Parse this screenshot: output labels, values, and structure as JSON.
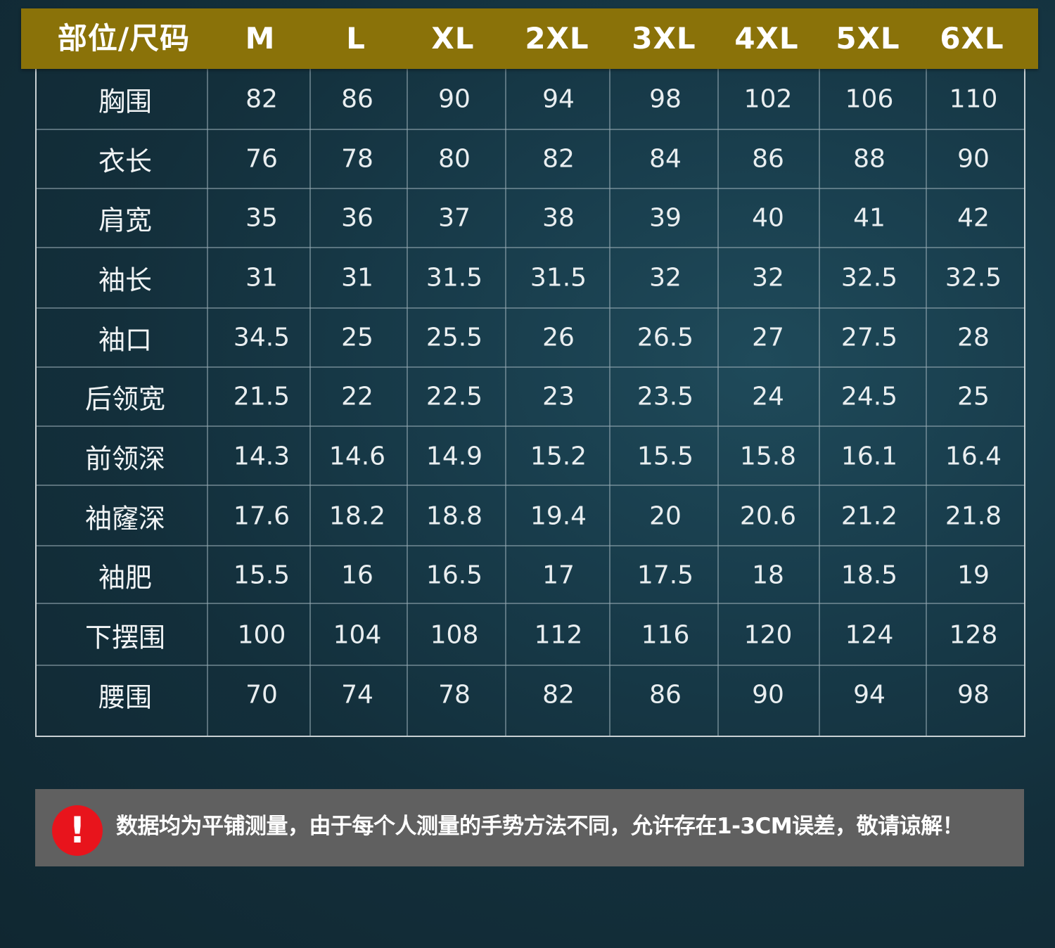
{
  "table": {
    "header": [
      "部位/尺码",
      "M",
      "L",
      "XL",
      "2XL",
      "3XL",
      "4XL",
      "5XL",
      "6XL"
    ],
    "rows": [
      {
        "label": "胸围",
        "values": [
          "82",
          "86",
          "90",
          "94",
          "98",
          "102",
          "106",
          "110"
        ]
      },
      {
        "label": "衣长",
        "values": [
          "76",
          "78",
          "80",
          "82",
          "84",
          "86",
          "88",
          "90"
        ]
      },
      {
        "label": "肩宽",
        "values": [
          "35",
          "36",
          "37",
          "38",
          "39",
          "40",
          "41",
          "42"
        ]
      },
      {
        "label": "袖长",
        "values": [
          "31",
          "31",
          "31.5",
          "31.5",
          "32",
          "32",
          "32.5",
          "32.5"
        ]
      },
      {
        "label": "袖口",
        "values": [
          "34.5",
          "25",
          "25.5",
          "26",
          "26.5",
          "27",
          "27.5",
          "28"
        ]
      },
      {
        "label": "后领宽",
        "values": [
          "21.5",
          "22",
          "22.5",
          "23",
          "23.5",
          "24",
          "24.5",
          "25"
        ]
      },
      {
        "label": "前领深",
        "values": [
          "14.3",
          "14.6",
          "14.9",
          "15.2",
          "15.5",
          "15.8",
          "16.1",
          "16.4"
        ]
      },
      {
        "label": "袖窿深",
        "values": [
          "17.6",
          "18.2",
          "18.8",
          "19.4",
          "20",
          "20.6",
          "21.2",
          "21.8"
        ]
      },
      {
        "label": "袖肥",
        "values": [
          "15.5",
          "16",
          "16.5",
          "17",
          "17.5",
          "18",
          "18.5",
          "19"
        ]
      },
      {
        "label": "下摆围",
        "values": [
          "100",
          "104",
          "108",
          "112",
          "116",
          "120",
          "124",
          "128"
        ]
      },
      {
        "label": "腰围",
        "values": [
          "70",
          "74",
          "78",
          "82",
          "86",
          "90",
          "94",
          "98"
        ]
      }
    ]
  },
  "notice": {
    "icon": "exclamation-icon",
    "icon_glyph": "!",
    "text": "数据均为平铺测量，由于每个人测量的手势方法不同，允许存在1-3CM误差，敬请谅解！"
  },
  "colors": {
    "header_bg": "#8a7209",
    "notice_bg": "#606060",
    "warn_red": "#e8141c"
  }
}
